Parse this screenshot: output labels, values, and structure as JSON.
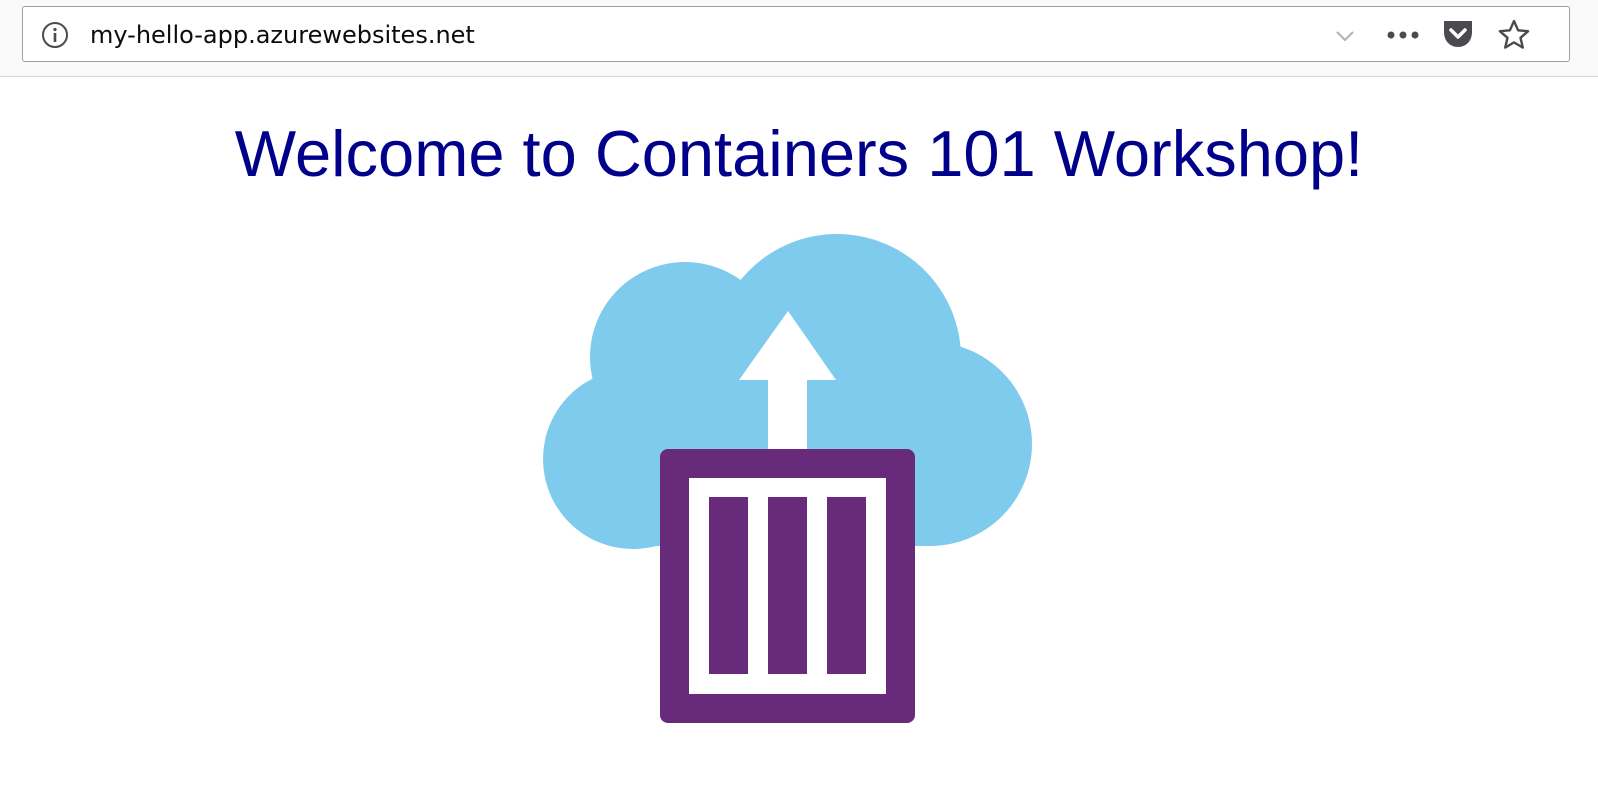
{
  "browser": {
    "url": "my-hello-app.azurewebsites.net",
    "icons": {
      "info": "info-icon",
      "dropdown": "chevron-down-icon",
      "menu": "more-dots-icon",
      "pocket": "pocket-icon",
      "bookmark": "star-icon"
    }
  },
  "page": {
    "heading": "Welcome to Containers 101 Workshop!",
    "heading_color": "#00008b",
    "logo": {
      "name": "cloud-container-logo",
      "cloud_color": "#7fcbee",
      "container_color": "#682a7a"
    }
  }
}
